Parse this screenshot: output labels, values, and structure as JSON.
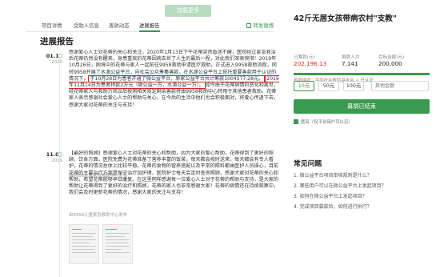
{
  "load_more": "加载更多",
  "tabs": [
    {
      "label": "项目详情"
    },
    {
      "label": "受助人信息"
    },
    {
      "label": "善款动态"
    },
    {
      "label": "进展报告"
    }
  ],
  "share_label": "转发微博",
  "section_title": "进展报告",
  "reports": [
    {
      "date": "01.14",
      "year": "2020",
      "text_before": "感谢爱心人士对花蒂的关心和关注，2020年1月13日下午花蒂突然昏迷不醒，医院经过紧急救治后花蒂仍然没有醒来，身患重疾的花蒂因病去世了人生的最后一程，对此我们深表惋惜！2019年10月26日，困境中的花蒂与家人一起前往9958救助申请医疗救助，正式进入9958救助流程，同时9958开展了水滴公益平台，向社会公众筹集善款，在水滴公益平台上依托重要善款用于认证的情况下，",
      "highlight_1": "于10月28日为患者开通了微公益平台，原家公益平台共计筹款1004577.28元。",
      "highlight_2": "2019年11月14日为患者转款2万元（微公益一万，水滴公益一万）。",
      "text_after": "如今由于花蒂病情的恶化和离世，经花蒂家人与救助方商议后按照相关规定剩余善款将由9958救助中心转用于其他患者救助。花蒂家人表示感谢社会爱心人士的帮助与关心，在今后的生活中他们也会积极面对，将爱心传递下去，感谢大家对花蒂的关注与支持！",
      "source": "由9958儿童紧急救助中心发布"
    },
    {
      "date": "11.04",
      "year": "2019",
      "text": "【最好的照顾】感谢爱心人士对花蒂的关心和帮助，因为大家的爱心帮助，花蒂得到了更好的照顾，饮食方面，医院免费为花蒂准备了营养丰富的饭菜，每天都会按时送来，每天都会有专人看护，花蒂的情况总体上比较平稳。花蒂的食物的营养搭配以及平常的照料都由医护人员操心，目前花蒂的主要治疗方案是保守治疗加护理，医院护士每天会定时查房照顾，感谢大家对花蒂的关心和帮助，希望花蒂能够早日康复。在这里同样感谢每一位爱心人士对于花蒂的帮助与支持，是大家的帮助让花蒂得到了更好的治疗和照顾，花蒂的家人也非常感谢大家！花蒂的病情还在持续观察中，我们会及时更新花蒂的情况，感谢大家的关注与支持！",
      "source": "由9958儿童紧急救助中心发布"
    }
  ],
  "project": {
    "title": "42斤无居女孩带病农村\"支教\"",
    "raised_label": "已筹款(元)",
    "raised_value": "202,196.13",
    "donors_label": "捐款人次",
    "donors_value": "7,141",
    "target_label": "目标金额(元)",
    "target_value": "200,000",
    "progress_fraction": 1.0,
    "verify_text_1": "善款接收：",
    "verify_text_2": "中华社会救助基金会",
    "verify_ok": "已认证",
    "amounts": [
      "10元",
      "50元",
      "100元"
    ],
    "amount_placeholder": "其他金额",
    "donate_label": "募捐已结束",
    "anon_label": "匿名（仅平台用户可以见）"
  },
  "faq": {
    "title": "常见问题",
    "items": [
      "1. 微公益平台项目审核规则是什么？",
      "2. 哪些用户可以在微公益平台上发起项目？",
      "3. 如何在微公益平台上发起项目？",
      "4. 完成项目募款后，如何进行执行？"
    ]
  },
  "colors": {
    "accent": "#3a9a4f",
    "highlight_border": "#e0261b"
  }
}
